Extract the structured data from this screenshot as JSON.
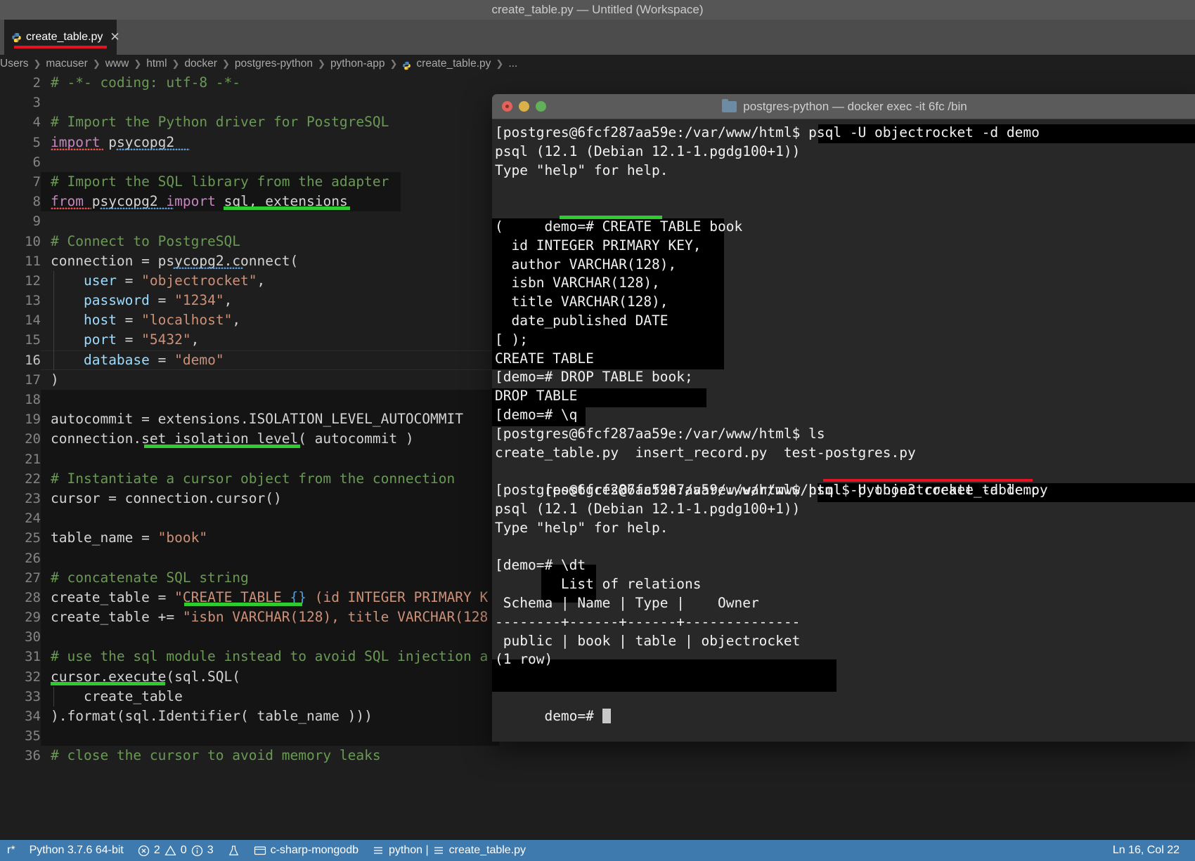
{
  "window": {
    "title": "create_table.py — Untitled (Workspace)"
  },
  "tab": {
    "label": "create_table.py",
    "close": "✕",
    "icon": "python-file-icon"
  },
  "breadcrumb": {
    "separator": "❯",
    "items": [
      "Users",
      "macuser",
      "www",
      "html",
      "docker",
      "postgres-python",
      "python-app",
      "create_table.py",
      "..."
    ]
  },
  "editor": {
    "lines": [
      {
        "n": "2",
        "text": "# -*- coding: utf-8 -*-"
      },
      {
        "n": "3",
        "text": ""
      },
      {
        "n": "4",
        "text": "# Import the Python driver for PostgreSQL"
      },
      {
        "n": "5",
        "text": "import psycopg2"
      },
      {
        "n": "6",
        "text": ""
      },
      {
        "n": "7",
        "text": "# Import the SQL library from the adapter"
      },
      {
        "n": "8",
        "text": "from psycopg2 import sql, extensions"
      },
      {
        "n": "9",
        "text": ""
      },
      {
        "n": "10",
        "text": "# Connect to PostgreSQL"
      },
      {
        "n": "11",
        "text": "connection = psycopg2.connect("
      },
      {
        "n": "12",
        "text": "    user = \"objectrocket\","
      },
      {
        "n": "13",
        "text": "    password = \"1234\","
      },
      {
        "n": "14",
        "text": "    host = \"localhost\","
      },
      {
        "n": "15",
        "text": "    port = \"5432\","
      },
      {
        "n": "16",
        "text": "    database = \"demo\""
      },
      {
        "n": "17",
        "text": ")"
      },
      {
        "n": "18",
        "text": ""
      },
      {
        "n": "19",
        "text": "autocommit = extensions.ISOLATION_LEVEL_AUTOCOMMIT"
      },
      {
        "n": "20",
        "text": "connection.set_isolation_level( autocommit )"
      },
      {
        "n": "21",
        "text": ""
      },
      {
        "n": "22",
        "text": "# Instantiate a cursor object from the connection"
      },
      {
        "n": "23",
        "text": "cursor = connection.cursor()"
      },
      {
        "n": "24",
        "text": ""
      },
      {
        "n": "25",
        "text": "table_name = \"book\""
      },
      {
        "n": "26",
        "text": ""
      },
      {
        "n": "27",
        "text": "# concatenate SQL string"
      },
      {
        "n": "28",
        "text": "create_table = \"CREATE TABLE {} (id INTEGER PRIMARY K"
      },
      {
        "n": "29",
        "text": "create_table += \"isbn VARCHAR(128), title VARCHAR(128"
      },
      {
        "n": "30",
        "text": ""
      },
      {
        "n": "31",
        "text": "# use the sql module instead to avoid SQL injection a"
      },
      {
        "n": "32",
        "text": "cursor.execute(sql.SQL("
      },
      {
        "n": "33",
        "text": "    create_table"
      },
      {
        "n": "34",
        "text": ").format(sql.Identifier( table_name )))"
      },
      {
        "n": "35",
        "text": ""
      },
      {
        "n": "36",
        "text": "# close the cursor to avoid memory leaks"
      }
    ]
  },
  "statusbar": {
    "remote_label": "r*",
    "interpreter": "Python 3.7.6 64-bit",
    "errors_icon": "error-circle-icon",
    "errors": "2",
    "warnings_icon": "warning-triangle-icon",
    "warnings": "0",
    "info_icon": "info-circle-icon",
    "info": "3",
    "beaker_icon": "beaker-icon",
    "source_control_icon": "source-control-icon",
    "source_control": "c-sharp-mongodb",
    "env_icon": "list-icon",
    "env": "python |",
    "file_icon": "list-icon",
    "file": "create_table.py",
    "position": "Ln 16, Col 22"
  },
  "terminal": {
    "title": "postgres-python — docker exec -it 6fc /bin",
    "folder_icon": "folder-icon",
    "traffic_lights": [
      "close-button",
      "minimize-button",
      "maximize-button"
    ],
    "lines": [
      "[postgres@6fcf287aa59e:/var/www/html$ psql -U objectrocket -d demo",
      "psql (12.1 (Debian 12.1-1.pgdg100+1))",
      "Type \"help\" for help.",
      "",
      "demo=# CREATE TABLE book",
      "(",
      "  id INTEGER PRIMARY KEY,",
      "  author VARCHAR(128),",
      "  isbn VARCHAR(128),",
      "  title VARCHAR(128),",
      "  date_published DATE",
      "[ );",
      "CREATE TABLE",
      "[demo=# DROP TABLE book;",
      "DROP TABLE",
      "[demo=# \\q",
      "[postgres@6fcf287aa59e:/var/www/html$ ls",
      "create_table.py  insert_record.py  test-postgres.py",
      "[postgres@6fcf287aa59e:/var/www/html$ python3 create_table.py",
      "[postgres@6fcf287aa59e:/var/www/html$ psql -U objectrocket -d demo",
      "psql (12.1 (Debian 12.1-1.pgdg100+1))",
      "Type \"help\" for help.",
      "",
      "[demo=# \\dt",
      "        List of relations",
      " Schema | Name | Type |    Owner",
      "--------+------+------+--------------",
      " public | book | table | objectrocket",
      "(1 row)",
      "",
      "demo=# "
    ],
    "prompt_command_1": "psql -U objectrocket -d demo",
    "prompt_command_2": "python3 create_table.py",
    "prompt_command_3": "\\dt",
    "sql_keyword": "CREATE TABLE"
  },
  "colors": {
    "accent_red": "#e81123",
    "accent_green": "#2ecc2e",
    "statusbar_blue": "#3e7aad",
    "editor_bg": "#1e1e1e",
    "terminal_bg": "#282828"
  }
}
